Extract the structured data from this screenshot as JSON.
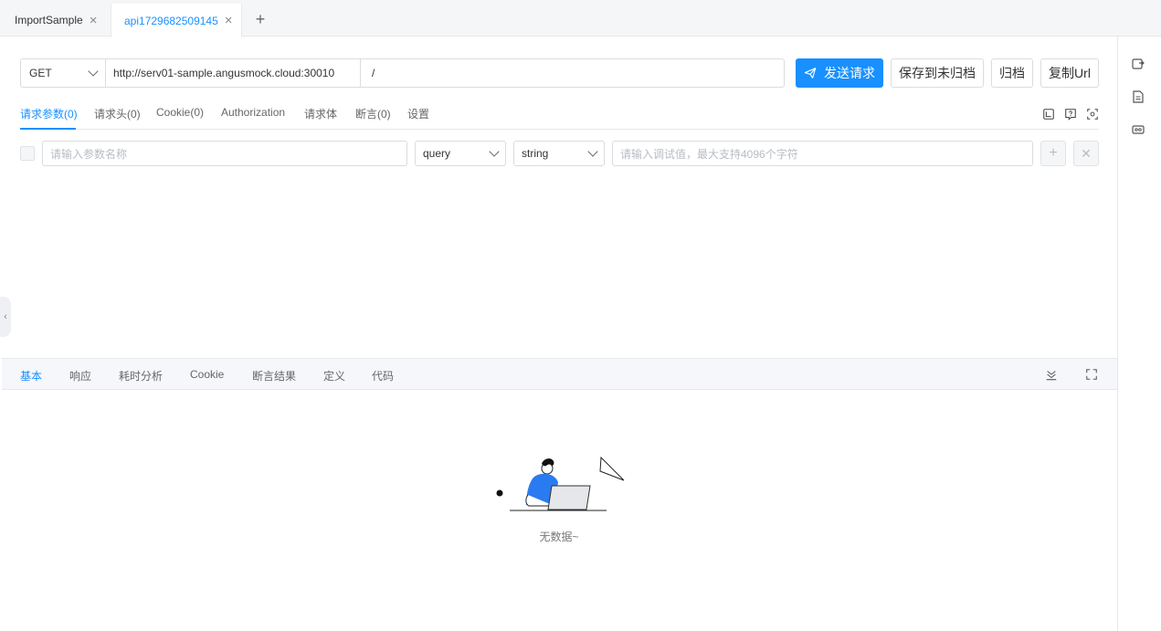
{
  "tabs": [
    {
      "label": "ImportSample",
      "active": false
    },
    {
      "label": "api1729682509145",
      "active": true
    }
  ],
  "request": {
    "method": "GET",
    "server": "http://serv01-sample.angusmock.cloud:30010",
    "path": "/",
    "buttons": {
      "send": "发送请求",
      "save": "保存到未归档",
      "archive": "归档",
      "copy_url": "复制Url"
    }
  },
  "request_tabs": [
    "请求参数(0)",
    "请求头(0)",
    "Cookie(0)",
    "Authorization",
    "请求体",
    "断言(0)",
    "设置"
  ],
  "params": {
    "name_placeholder": "请输入参数名称",
    "in": "query",
    "type": "string",
    "value_placeholder": "请输入调试值，最大支持4096个字符"
  },
  "response_tabs": [
    "基本",
    "响应",
    "耗时分析",
    "Cookie",
    "断言结果",
    "定义",
    "代码"
  ],
  "empty_text": "无数据~",
  "colors": {
    "accent": "#1890ff",
    "border": "#d9dce1",
    "tabbar_bg": "#f5f6f8"
  },
  "icons": {
    "rail": [
      "api-sync-icon",
      "document-icon",
      "variable-icon"
    ],
    "request_tools": [
      "code-editor-icon",
      "help-icon",
      "scan-icon"
    ],
    "response_tools": [
      "collapse-down-icon",
      "fullscreen-icon"
    ]
  }
}
